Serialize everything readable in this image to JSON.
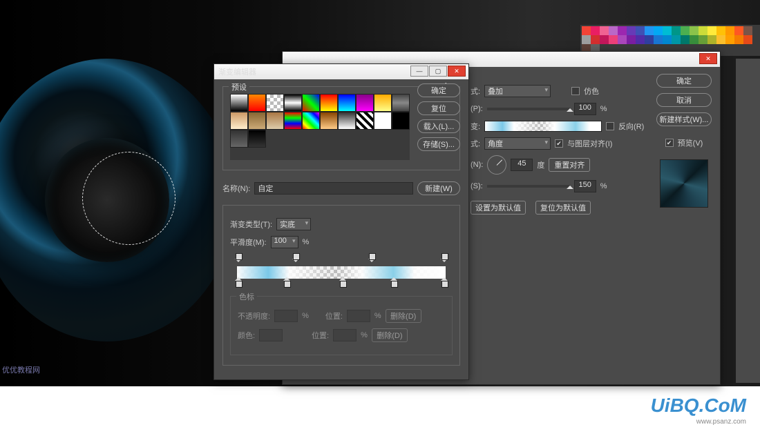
{
  "dlg1": {
    "title": "渐变编辑器",
    "presets_label": "预设",
    "buttons": {
      "ok": "确定",
      "reset": "复位",
      "load": "载入(L)...",
      "save": "存储(S)..."
    },
    "name_label": "名称(N):",
    "name_value": "自定",
    "new_btn": "新建(W)",
    "grad_type_label": "渐变类型(T):",
    "grad_type_value": "实底",
    "smooth_label": "平滑度(M):",
    "smooth_value": "100",
    "pct": "%",
    "stops_label": "色标",
    "opacity_label": "不透明度:",
    "pos_label": "位置:",
    "del_btn": "删除(D)",
    "color_label": "颜色:"
  },
  "dlg2": {
    "buttons": {
      "ok": "确定",
      "cancel": "取消",
      "newstyle": "新建样式(W)..."
    },
    "preview_chk": "预览(V)",
    "mode_label": "式:",
    "mode_value": "叠加",
    "dither": "仿色",
    "opacity_label": "(P):",
    "opacity_value": "100",
    "pct": "%",
    "reverse": "反向(R)",
    "grad_label": "变:",
    "style_label": "式:",
    "style_value": "角度",
    "align": "与图层对齐(I)",
    "angle_label": "(N):",
    "angle_value": "45",
    "deg": "度",
    "reset_align": "重置对齐",
    "scale_label": "(S):",
    "scale_value": "150",
    "set_default": "设置为默认值",
    "reset_default": "复位为默认值"
  },
  "wm": {
    "t1": "优优教程网",
    "t2": "UiBQ.CoM",
    "t3": "www.psanz.com"
  },
  "swatches": [
    "#f44336",
    "#e91e63",
    "#f06292",
    "#ba68c8",
    "#9c27b0",
    "#673ab7",
    "#3f51b5",
    "#2196f3",
    "#03a9f4",
    "#00bcd4",
    "#009688",
    "#4caf50",
    "#8bc34a",
    "#cddc39",
    "#ffeb3b",
    "#ffc107",
    "#ff9800",
    "#ff5722",
    "#795548",
    "#9e9e9e",
    "#d32f2f",
    "#c2185b",
    "#ec407a",
    "#ab47bc",
    "#7b1fa2",
    "#512da8",
    "#303f9f",
    "#1976d2",
    "#0288d1",
    "#0097a7",
    "#00796b",
    "#388e3c",
    "#689f38",
    "#afb42b",
    "#fbc02d",
    "#ffa000",
    "#f57c00",
    "#e64a19",
    "#5d4037",
    "#616161"
  ],
  "preset_gradients": [
    "linear-gradient(#fff,#000)",
    "linear-gradient(#f80,#f00)",
    "repeating-conic-gradient(#bbb 0 25%,#fff 0 50%)",
    "linear-gradient(#000,#fff,#000)",
    "linear-gradient(45deg,#f00,#0f0,#00f)",
    "linear-gradient(#f00,#ff0)",
    "linear-gradient(#00f,#0ff)",
    "linear-gradient(#808,#f0f)",
    "linear-gradient(#fa0,#ff8)",
    "linear-gradient(#444,#888,#444)",
    "linear-gradient(#c96,#fec)",
    "linear-gradient(#863,#ca7)",
    "linear-gradient(#a74,#dca)",
    "linear-gradient(#f00,#0f0,#00f,#f00)",
    "linear-gradient(45deg,#f00,#ff0,#0f0,#0ff,#00f,#f0f)",
    "linear-gradient(#840,#fc8)",
    "linear-gradient(#333,#fff)",
    "repeating-linear-gradient(45deg,#000 0 4px,#fff 4px 8px)",
    "linear-gradient(#fff,#fff)",
    "linear-gradient(#000,#000)",
    "linear-gradient(#333,#666)",
    "linear-gradient(#000,#333)"
  ],
  "chart_data": null
}
